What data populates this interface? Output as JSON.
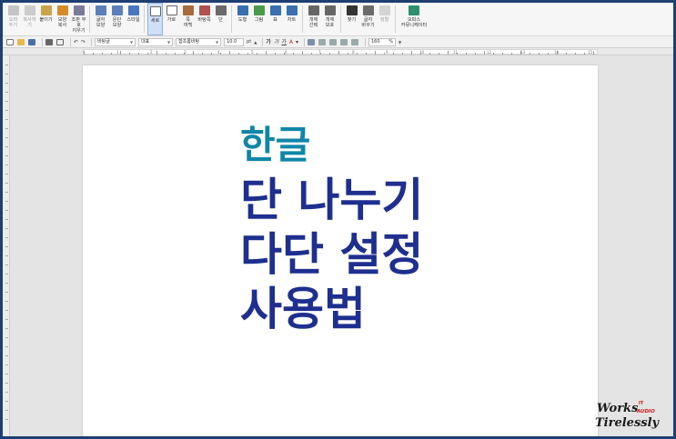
{
  "ribbon": {
    "buttons": [
      {
        "label": "오려\n두기",
        "icon": "cut-icon",
        "disabled": true
      },
      {
        "label": "복사하기",
        "icon": "copy-icon",
        "disabled": true
      },
      {
        "label": "붙이기",
        "icon": "paste-icon",
        "disabled": false
      },
      {
        "label": "모양\n복사",
        "icon": "format-painter-icon",
        "disabled": false
      },
      {
        "label": "조판 부호\n지우기",
        "icon": "clear-markup-icon",
        "disabled": false
      },
      {
        "label": "글자\n모양",
        "icon": "char-shape-icon",
        "disabled": false
      },
      {
        "label": "문단\n모양",
        "icon": "paragraph-shape-icon",
        "disabled": false
      },
      {
        "label": "스타일",
        "icon": "style-icon",
        "disabled": false
      },
      {
        "label": "세로",
        "icon": "portrait-icon",
        "disabled": false,
        "active": true
      },
      {
        "label": "가로",
        "icon": "landscape-icon",
        "disabled": false
      },
      {
        "label": "쪽\n여백",
        "icon": "page-margin-icon",
        "disabled": false
      },
      {
        "label": "바탕쪽",
        "icon": "master-page-icon",
        "disabled": false
      },
      {
        "label": "단",
        "icon": "columns-icon",
        "disabled": false
      },
      {
        "label": "도형",
        "icon": "shape-icon",
        "disabled": false
      },
      {
        "label": "그림",
        "icon": "picture-icon",
        "disabled": false
      },
      {
        "label": "표",
        "icon": "table-icon",
        "disabled": false
      },
      {
        "label": "차트",
        "icon": "chart-icon",
        "disabled": false
      },
      {
        "label": "개체\n선택",
        "icon": "object-select-icon",
        "disabled": false
      },
      {
        "label": "개체\n보호",
        "icon": "object-protect-icon",
        "disabled": false
      },
      {
        "label": "찾기",
        "icon": "find-icon",
        "disabled": false
      },
      {
        "label": "글자\n바꾸기",
        "icon": "replace-icon",
        "disabled": false
      },
      {
        "label": "정렬",
        "icon": "sort-icon",
        "disabled": true
      },
      {
        "label": "오피스\n커뮤니케이터",
        "icon": "office-communicator-icon",
        "disabled": false
      }
    ]
  },
  "format_bar": {
    "style_value": "바탕글",
    "font_lang_value": "대표",
    "font_value": "함초롬바탕",
    "font_size_value": "10.0",
    "size_unit": "pt",
    "zoom_value": "160",
    "zoom_unit": "%"
  },
  "ruler": {
    "numbers": [
      "1",
      "2",
      "3",
      "4",
      "5",
      "6",
      "7",
      "8",
      "9",
      "10",
      "11",
      "12",
      "13",
      "14",
      "15"
    ]
  },
  "document": {
    "line1": "한글",
    "line2": "단 나누기",
    "line3": "다단 설정",
    "line4": "사용법"
  },
  "watermark": {
    "line1": "Works",
    "badge_it": "IT",
    "badge_audio": "AUDIO",
    "line2": "Tirelessly"
  },
  "colors": {
    "title_teal": "#0f86a8",
    "title_navy": "#1e2f8f",
    "frame_border": "#1f3f73"
  }
}
